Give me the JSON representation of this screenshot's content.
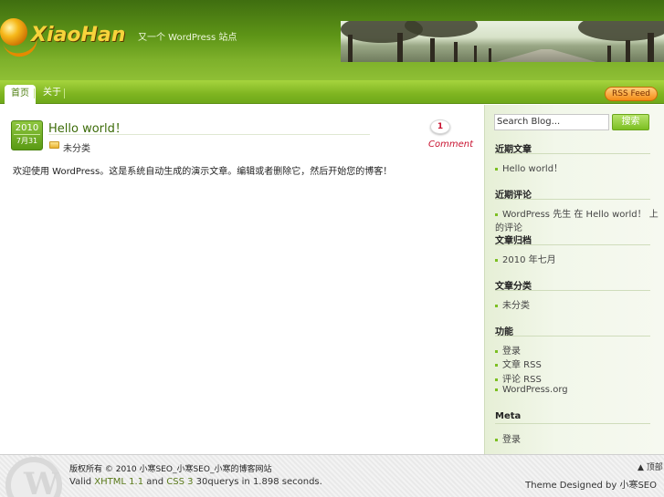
{
  "header": {
    "logo_text": "XiaoHan",
    "tagline": "又一个 WordPress 站点"
  },
  "nav": {
    "items": [
      {
        "label": "首页"
      },
      {
        "label": "关于"
      }
    ],
    "rss_label": "RSS Feed"
  },
  "post": {
    "year": "2010",
    "month_day": "7月31",
    "title": "Hello world！",
    "category": "未分类",
    "comment_count": "1",
    "comment_label": "Comment",
    "body": "欢迎使用 WordPress。这是系统自动生成的演示文章。编辑或者删除它，然后开始您的博客！"
  },
  "sidebar": {
    "search_placeholder": "Search Blog...",
    "search_button": "搜索",
    "widgets": [
      {
        "title": "近期文章",
        "items": [
          "Hello world！"
        ]
      },
      {
        "title": "近期评论",
        "items": [
          "WordPress 先生 在 Hello world！ 上的评论"
        ]
      },
      {
        "title": "文章归档",
        "items": [
          "2010 年七月"
        ]
      },
      {
        "title": "文章分类",
        "items": [
          "未分类"
        ]
      },
      {
        "title": "功能",
        "items": [
          "登录",
          "文章 RSS",
          "评论 RSS",
          "WordPress.org"
        ]
      },
      {
        "title": "Meta",
        "items": [
          "登录"
        ]
      }
    ]
  },
  "footer": {
    "copyright": "版权所有 © 2010 小寒SEO_小寒SEO_小寒的博客网站",
    "valid_prefix": "Valid",
    "xhtml": "XHTML 1.1",
    "and": "and",
    "css": "CSS 3",
    "stats": "30querys in 1.898 seconds.",
    "back_top": "顶部",
    "theme_credit": "Theme Designed by 小寒SEO"
  },
  "colors": {
    "brand_green": "#7fb521",
    "accent_red": "#c8102e",
    "rss_orange": "#f48b16"
  }
}
